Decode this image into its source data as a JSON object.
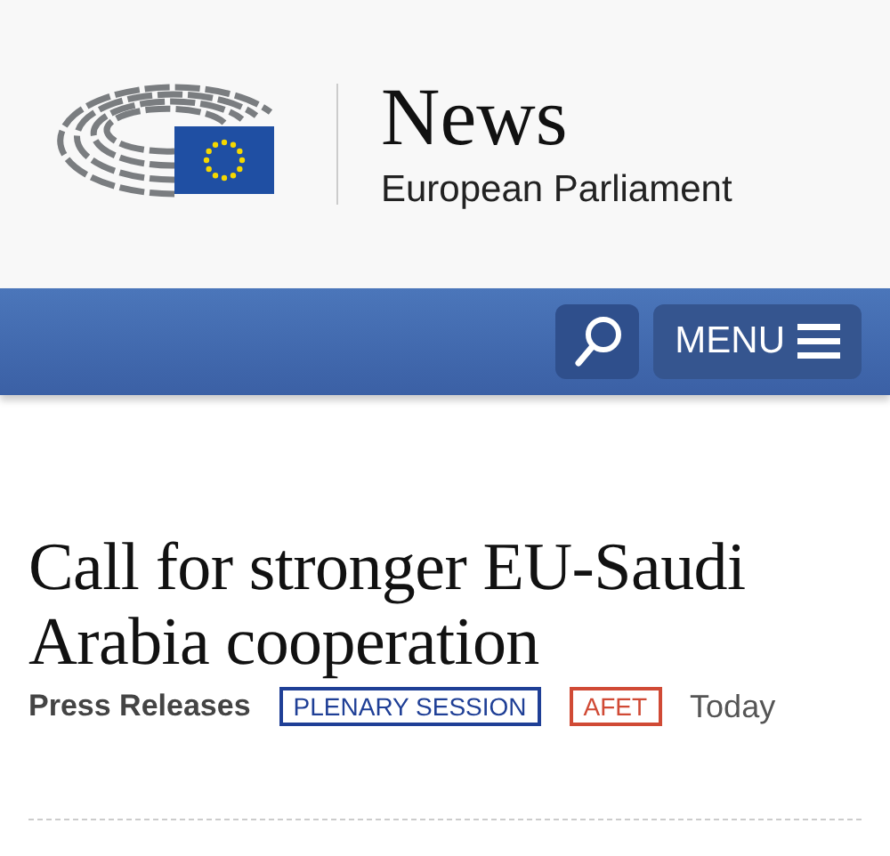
{
  "header": {
    "title": "News",
    "subtitle": "European Parliament"
  },
  "nav": {
    "menu_label": "MENU"
  },
  "article": {
    "title": "Call for stronger EU-Saudi Arabia cooperation",
    "category": "Press Releases",
    "tags": [
      {
        "label": "PLENARY SESSION",
        "color": "#1f3f96"
      },
      {
        "label": "AFET",
        "color": "#d04a35"
      }
    ],
    "date": "Today"
  }
}
